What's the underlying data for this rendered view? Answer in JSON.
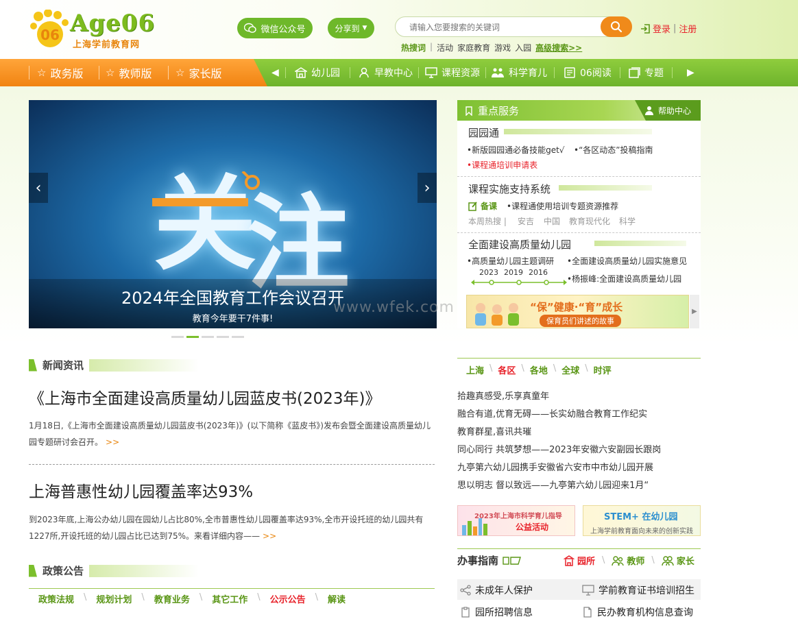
{
  "header": {
    "logo_brand": "Age06",
    "logo_sub": "上海学前教育网",
    "wechat_label": "微信公众号",
    "share_label": "分享到",
    "search_placeholder": "请输入您要搜索的关键词",
    "hot_label": "热搜词",
    "hot_words": [
      "活动",
      "家庭教育",
      "游戏",
      "入园"
    ],
    "advanced_search": "高级搜索>>",
    "login": "登录",
    "register": "注册"
  },
  "nav": {
    "versions": [
      "政务版",
      "教师版",
      "家长版"
    ],
    "channels": [
      "幼儿园",
      "早教中心",
      "课程资源",
      "科学育儿",
      "06阅读",
      "专题"
    ]
  },
  "slider": {
    "big_chars": [
      "关",
      "注"
    ],
    "title": "2024年全国教育工作会议召开",
    "subtitle": "教育今年要干7件事!",
    "dot_count": 5,
    "active_dot": 1
  },
  "services": {
    "title": "重点服务",
    "help": "帮助中心",
    "sec1": {
      "title": "园园通",
      "links": [
        "•新版园园通必备技能get√",
        "•“各区动态”投稿指南"
      ],
      "red_link": "•课程通培训申请表"
    },
    "sec2": {
      "title": "课程实施支持系统",
      "beike": "备课",
      "link": "•课程通使用培训专题资源推荐",
      "hot_label": "本周热搜",
      "hot_words": [
        "安吉",
        "中国",
        "教育现代化",
        "科学"
      ]
    },
    "sec3": {
      "title": "全面建设高质量幼儿园",
      "links": [
        "•高质量幼儿园主题调研",
        "•全面建设高质量幼儿园实施意见",
        "•杨振峰:全面建设高质量幼儿园"
      ],
      "years": [
        "2023",
        "2019",
        "2016"
      ]
    },
    "promo_title": "“保”健康·“育”成长",
    "promo_sub": "保育员们讲述的故事"
  },
  "watermark": "www.wfek.com",
  "news": {
    "title": "新闻资讯",
    "items": [
      {
        "headline": "《上海市全面建设高质量幼儿园蓝皮书(2023年)》",
        "summary": "1月18日,《上海市全面建设高质量幼儿园蓝皮书(2023年)》(以下简称《蓝皮书》)发布会暨全面建设高质量幼儿园专题研讨会召开。",
        "more": ">>"
      },
      {
        "headline": "上海普惠性幼儿园覆盖率达93%",
        "summary": "到2023年底,上海公办幼儿园在园幼儿占比80%,全市普惠性幼儿园覆盖率达93%,全市开设托班的幼儿园共有1227所,开设托班的幼儿园占比已达到75%。来看详细内容——",
        "more": ">>"
      }
    ]
  },
  "policy": {
    "title": "政策公告",
    "tabs": [
      "政策法规",
      "规划计划",
      "教育业务",
      "其它工作",
      "公示公告",
      "解读"
    ],
    "active_tab": 4
  },
  "regional": {
    "tabs": [
      "上海",
      "各区",
      "各地",
      "全球",
      "时评"
    ],
    "active_tab": 1,
    "items": [
      "拾趣真感受,乐享真童年",
      "融合有道,优育无碍——长实幼融合教育工作纪实",
      "教育群星,喜讯共璀",
      "同心同行 共筑梦想——2023年安徽六安副园长跟岗",
      "九亭第六幼儿园携手安徽省六安市中市幼儿园开展",
      "思以明志 督以致远——九亭第六幼儿园迎来1月“"
    ]
  },
  "ads": {
    "ad1_title": "2023年上海市科学育儿指导",
    "ad1_sub": "公益活动",
    "ad2_title": "在幼儿园",
    "ad2_sub": "上海学前教育面向未来的创新实践"
  },
  "guide": {
    "title": "办事指南",
    "tabs": [
      "园所",
      "教师",
      "家长"
    ],
    "active_tab": 0,
    "items": [
      "未成年人保护",
      "学前教育证书培训招生",
      "园所招聘信息",
      "民办教育机构信息查询"
    ]
  },
  "colors": {
    "green": "#7bbf2c",
    "orange": "#f18312",
    "red": "#e8232b"
  }
}
